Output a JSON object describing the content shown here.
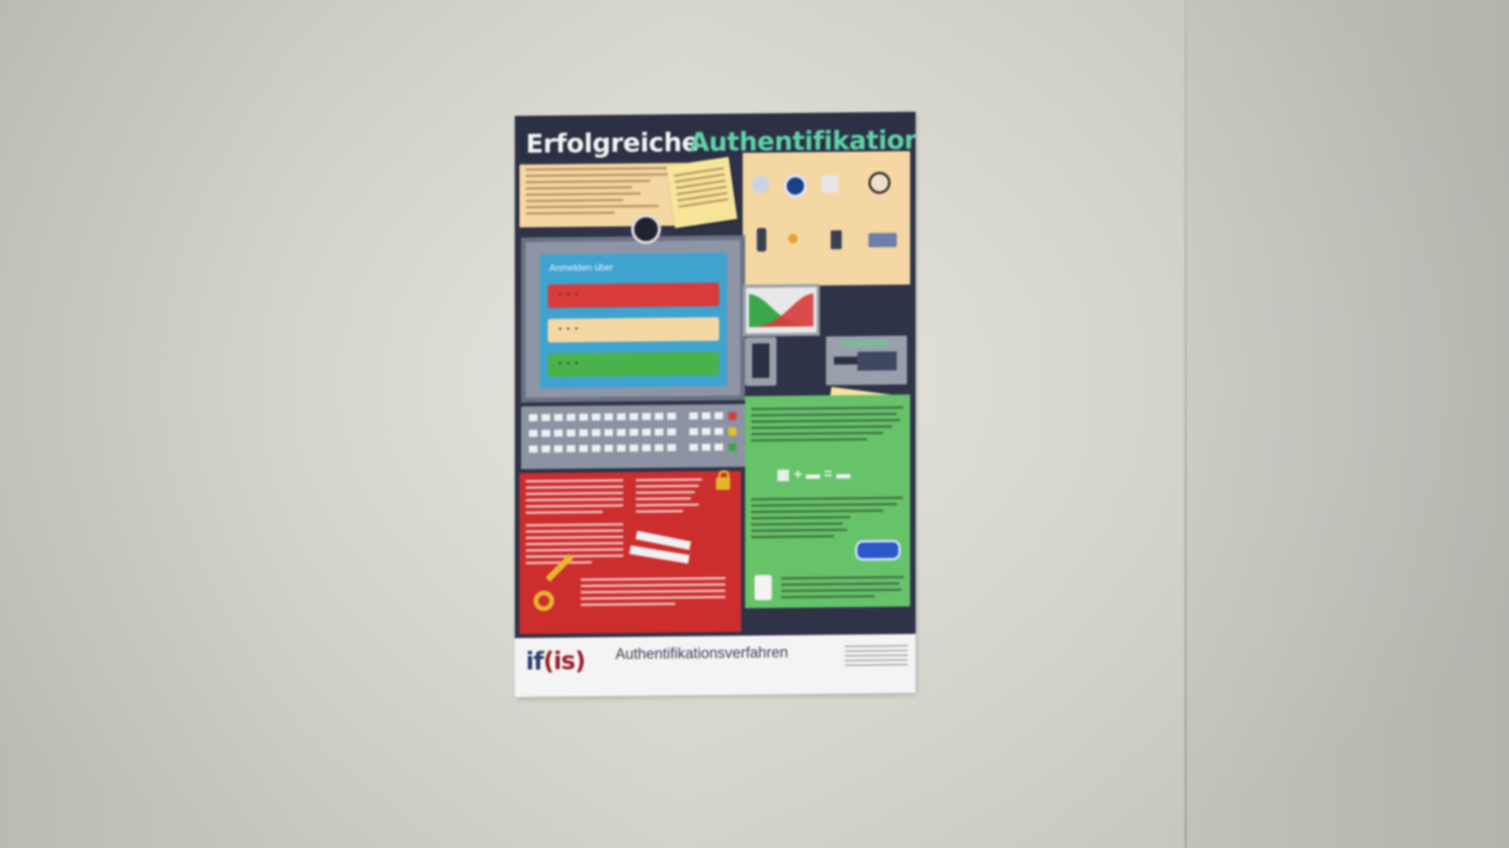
{
  "poster": {
    "title_word1": "Erfolgreiche",
    "title_word2": "Authentifikation",
    "screen_title": "Anmelden über",
    "footer": {
      "logo_prefix": "if",
      "logo_accent": "(is)",
      "title": "Authentifikationsverfahren"
    }
  },
  "colors": {
    "wall": "#dcdcd4",
    "poster_navy": "#2e3347",
    "title_green": "#5fd2a8",
    "panel_red": "#cc2d2d",
    "panel_green": "#66c36a",
    "panel_peach": "#f4d7a3",
    "screen_blue": "#3fa3d0"
  }
}
